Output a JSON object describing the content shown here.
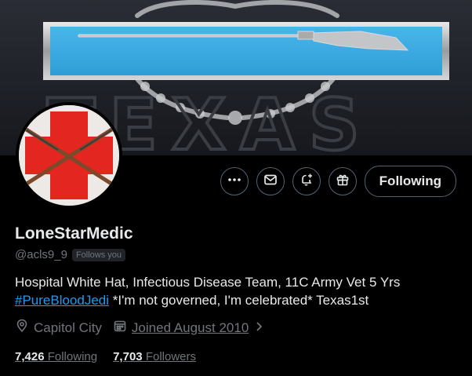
{
  "profile": {
    "display_name": "LoneStarMedic",
    "handle": "@acls9_9",
    "follows_you": "Follows you",
    "bio_line1": "Hospital White Hat, Infectious Disease Team, 11C Army Vet 5 Yrs",
    "bio_hashtag": "#PureBloodJedi",
    "bio_line2_rest": " *I'm not governed, I'm celebrated* Texas1st",
    "location": "Capitol City",
    "joined": "Joined August 2010",
    "following_count": "7,426",
    "following_label": "Following",
    "followers_count": "7,703",
    "followers_label": "Followers"
  },
  "actions": {
    "more_icon": "more-icon",
    "message_icon": "mail-icon",
    "notify_icon": "bell-plus-icon",
    "gift_icon": "gift-icon",
    "follow_label": "Following"
  },
  "banner_text": "TEXAS",
  "colors": {
    "background": "#000000",
    "text_primary": "#e7e9ea",
    "text_secondary": "#71767b",
    "link": "#1d9bf0",
    "border": "#536471",
    "badge_blue": "#3aa9e0",
    "red_cross": "#e3261f"
  }
}
